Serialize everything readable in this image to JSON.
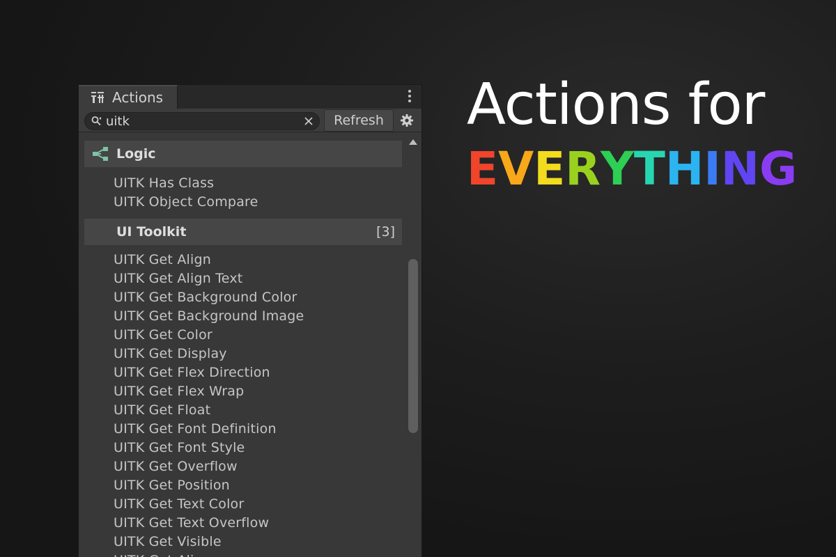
{
  "window": {
    "tab_label": "Actions",
    "tab_icon": "actions-icon",
    "menu_icon": "kebab-menu-icon"
  },
  "toolbar": {
    "search_value": "uitk",
    "search_icon": "search-icon",
    "clear_icon": "clear-icon",
    "refresh_label": "Refresh",
    "settings_icon": "gear-icon"
  },
  "categories": [
    {
      "label": "Logic",
      "icon": "logic-graph-icon",
      "count": "",
      "items": [
        "UITK Has Class",
        "UITK Object Compare"
      ]
    },
    {
      "label": "UI Toolkit",
      "icon": "",
      "count": "[3]",
      "items": [
        "UITK Get Align",
        "UITK Get Align Text",
        "UITK Get Background Color",
        "UITK Get Background Image",
        "UITK Get Color",
        "UITK Get Display",
        "UITK Get Flex Direction",
        "UITK Get Flex Wrap",
        "UITK Get Float",
        "UITK Get Font Definition",
        "UITK Get Font Style",
        "UITK Get Overflow",
        "UITK Get Position",
        "UITK Get Text Color",
        "UITK Get Text Overflow",
        "UITK Get Visible",
        "UITK Get Align"
      ]
    }
  ],
  "hero": {
    "title": "Actions for",
    "subtitle_letters": [
      "E",
      "V",
      "E",
      "R",
      "Y",
      "T",
      "H",
      "I",
      "N",
      "G"
    ],
    "subtitle_colors": [
      "#f0452b",
      "#f8a818",
      "#f2dc1d",
      "#9ad11e",
      "#2dcf55",
      "#27d6b1",
      "#2bb4f0",
      "#3b7cf5",
      "#6045f3",
      "#8a3cf2"
    ]
  },
  "colors": {
    "panel_bg": "#383838",
    "category_bg": "#464646",
    "logic_icon": "#7fc3a5",
    "text": "#c6c6c6"
  }
}
